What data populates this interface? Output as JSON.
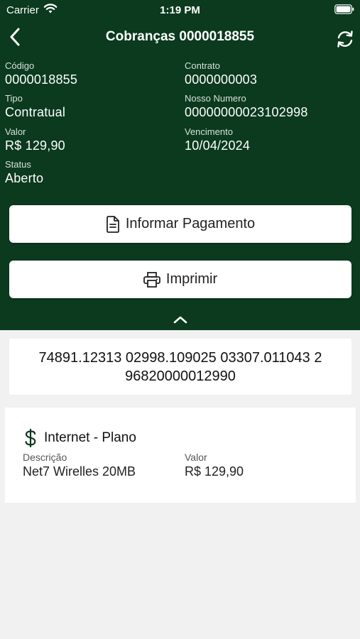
{
  "status_bar": {
    "carrier": "Carrier",
    "time": "1:19 PM"
  },
  "header": {
    "title": "Cobranças 0000018855"
  },
  "fields": {
    "codigo": {
      "label": "Código",
      "value": "0000018855"
    },
    "contrato": {
      "label": "Contrato",
      "value": "0000000003"
    },
    "tipo": {
      "label": "Tipo",
      "value": "Contratual"
    },
    "nosso_numero": {
      "label": "Nosso Numero",
      "value": "00000000023102998"
    },
    "valor": {
      "label": "Valor",
      "value": "R$ 129,90"
    },
    "vencimento": {
      "label": "Vencimento",
      "value": "10/04/2024"
    },
    "status": {
      "label": "Status",
      "value": "Aberto"
    }
  },
  "actions": {
    "informar_pagamento": "Informar Pagamento",
    "imprimir": "Imprimir"
  },
  "barcode": {
    "line1": "74891.12313 02998.109025 03307.011043 2",
    "line2": "96820000012990"
  },
  "item": {
    "title": "Internet - Plano",
    "descricao_label": "Descrição",
    "descricao_value": "Net7 Wirelles 20MB",
    "valor_label": "Valor",
    "valor_value": "R$ 129,90"
  },
  "colors": {
    "header_bg": "#0b3a1e",
    "accent_green": "#0b3a1e",
    "page_bg": "#f1f1f1"
  },
  "icons": [
    "wifi-icon",
    "battery-icon",
    "back-chevron-icon",
    "refresh-icon",
    "document-icon",
    "printer-icon",
    "chevron-up-icon",
    "dollar-icon"
  ]
}
